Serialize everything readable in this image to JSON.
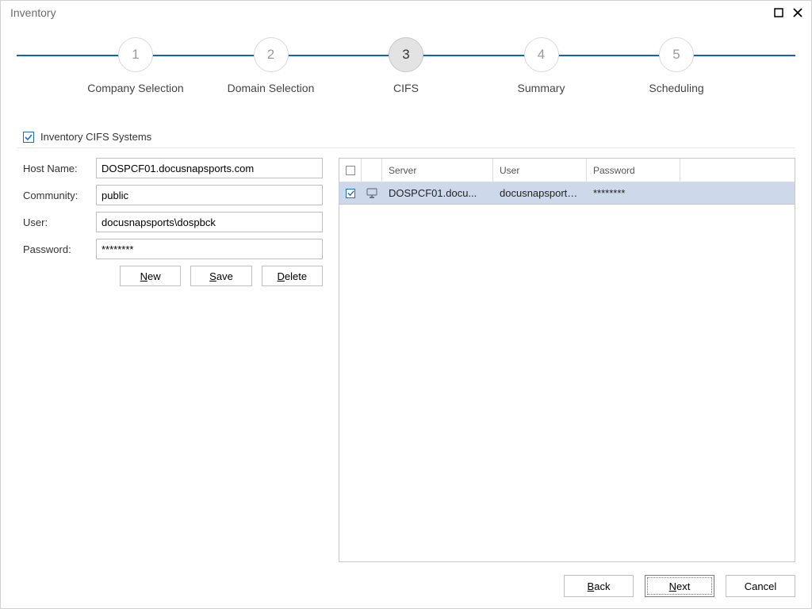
{
  "window": {
    "title": "Inventory"
  },
  "steps": [
    {
      "num": "1",
      "label": "Company Selection"
    },
    {
      "num": "2",
      "label": "Domain Selection"
    },
    {
      "num": "3",
      "label": "CIFS"
    },
    {
      "num": "4",
      "label": "Summary"
    },
    {
      "num": "5",
      "label": "Scheduling"
    }
  ],
  "checkbox": {
    "label": "Inventory CIFS Systems"
  },
  "form": {
    "hostname_label": "Host Name:",
    "hostname_value": "DOSPCF01.docusnapsports.com",
    "community_label": "Community:",
    "community_value": "public",
    "user_label": "User:",
    "user_value": "docusnapsports\\dospbck",
    "password_label": "Password:",
    "password_value": "********",
    "buttons": {
      "new": "New",
      "save": "Save",
      "delete": "Delete"
    }
  },
  "table": {
    "headers": {
      "server": "Server",
      "user": "User",
      "password": "Password"
    },
    "rows": [
      {
        "server": "DOSPCF01.docu...",
        "user": "docusnapsports\\...",
        "password": "********"
      }
    ]
  },
  "footer": {
    "back": "Back",
    "next": "Next",
    "cancel": "Cancel"
  }
}
